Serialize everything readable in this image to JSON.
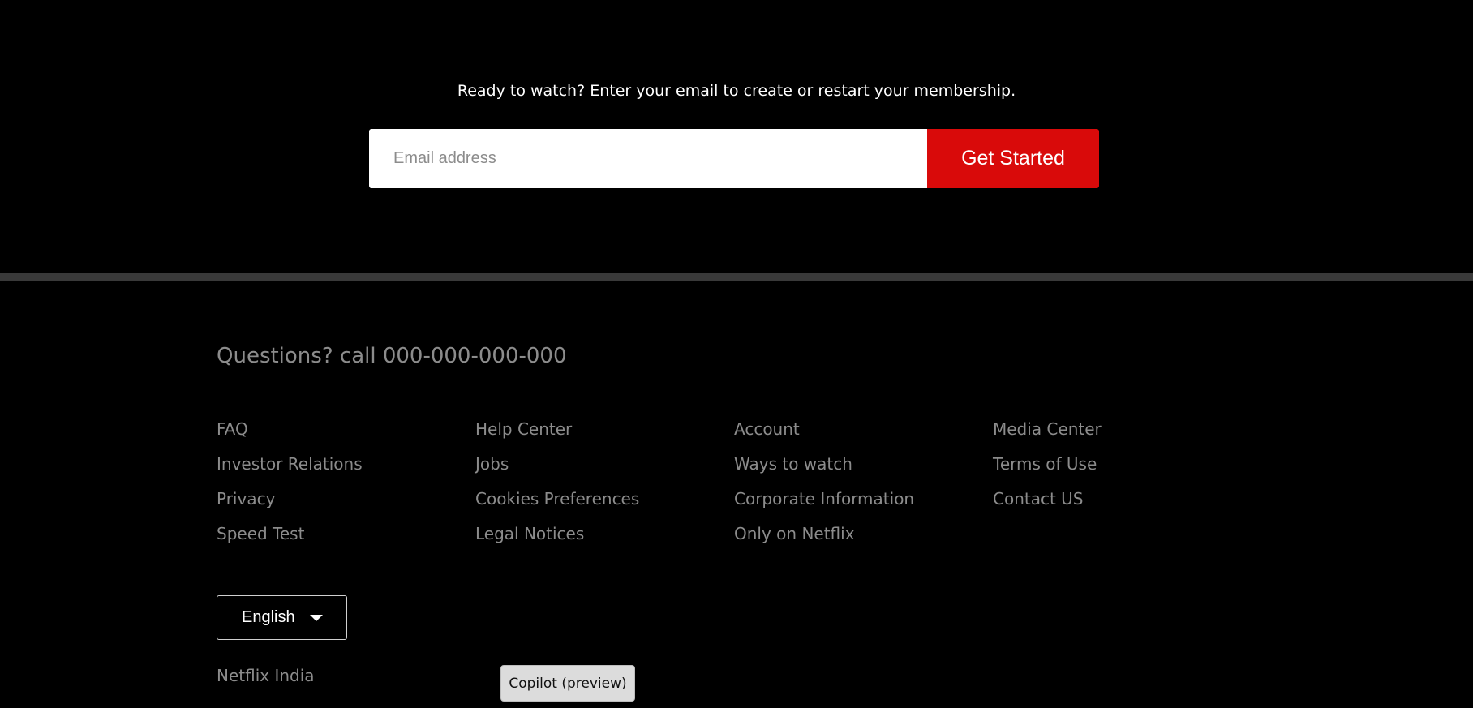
{
  "cta": {
    "text": "Ready to watch? Enter your email to create or restart your membership.",
    "email_placeholder": "Email address",
    "button_label": "Get Started"
  },
  "footer": {
    "questions": "Questions? call 000-000-000-000",
    "columns": [
      [
        "FAQ",
        "Investor Relations",
        "Privacy",
        "Speed Test"
      ],
      [
        "Help Center",
        "Jobs",
        "Cookies Preferences",
        "Legal Notices"
      ],
      [
        "Account",
        "Ways to watch",
        "Corporate Information",
        "Only on Netflix"
      ],
      [
        "Media Center",
        "Terms of Use",
        "Contact US"
      ]
    ],
    "language": {
      "selected": "English"
    },
    "country": "Netflix India"
  },
  "overlay": {
    "copilot_label": "Copilot (preview)"
  },
  "colors": {
    "background": "#000000",
    "brand_red": "#d90a0a",
    "muted_text": "#8c8c8c",
    "divider": "#393939"
  }
}
